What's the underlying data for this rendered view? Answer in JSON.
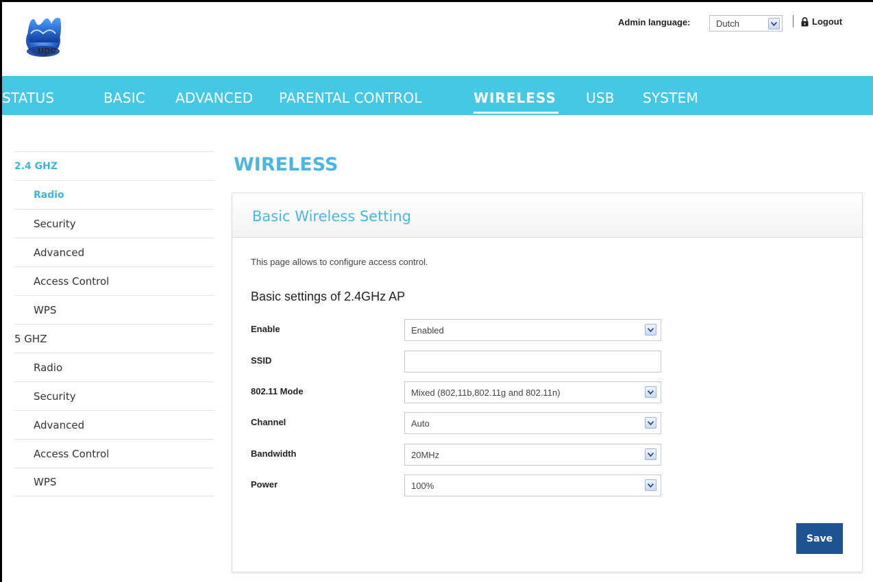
{
  "header": {
    "logo_text": "upc",
    "admin_language_label": "Admin language:",
    "admin_language_value": "Dutch",
    "logout_label": "Logout"
  },
  "nav": {
    "items": [
      "STATUS",
      "BASIC",
      "ADVANCED",
      "PARENTAL CONTROL",
      "WIRELESS",
      "USB",
      "SYSTEM"
    ],
    "active": "WIRELESS"
  },
  "sidebar": {
    "items": [
      {
        "label": "2.4 GHZ",
        "kind": "section",
        "active": true
      },
      {
        "label": "Radio",
        "kind": "sub",
        "active": true
      },
      {
        "label": "Security",
        "kind": "sub"
      },
      {
        "label": "Advanced",
        "kind": "sub"
      },
      {
        "label": "Access Control",
        "kind": "sub"
      },
      {
        "label": "WPS",
        "kind": "sub"
      },
      {
        "label": "5 GHZ",
        "kind": "section"
      },
      {
        "label": "Radio",
        "kind": "sub"
      },
      {
        "label": "Security",
        "kind": "sub"
      },
      {
        "label": "Advanced",
        "kind": "sub"
      },
      {
        "label": "Access Control",
        "kind": "sub"
      },
      {
        "label": "WPS",
        "kind": "sub"
      }
    ]
  },
  "main": {
    "page_title": "WIRELESS",
    "panel_title": "Basic Wireless Setting",
    "description": "This page allows to configure access control.",
    "subheading": "Basic settings of 2.4GHz AP",
    "fields": [
      {
        "label": "Enable",
        "value": "Enabled",
        "type": "select"
      },
      {
        "label": "SSID",
        "value": "",
        "type": "input"
      },
      {
        "label": "802.11 Mode",
        "value": "Mixed (802,11b,802.11g and 802.11n)",
        "type": "select"
      },
      {
        "label": "Channel",
        "value": "Auto",
        "type": "select"
      },
      {
        "label": "Bandwidth",
        "value": "20MHz",
        "type": "select"
      },
      {
        "label": "Power",
        "value": "100%",
        "type": "select"
      }
    ],
    "save_label": "Save"
  },
  "colors": {
    "nav_bg": "#45c8e4",
    "accent": "#4cb6e0",
    "save_button": "#1f5394"
  },
  "icons": [
    "upc-logo",
    "lock-icon",
    "chevron-down-icon"
  ]
}
